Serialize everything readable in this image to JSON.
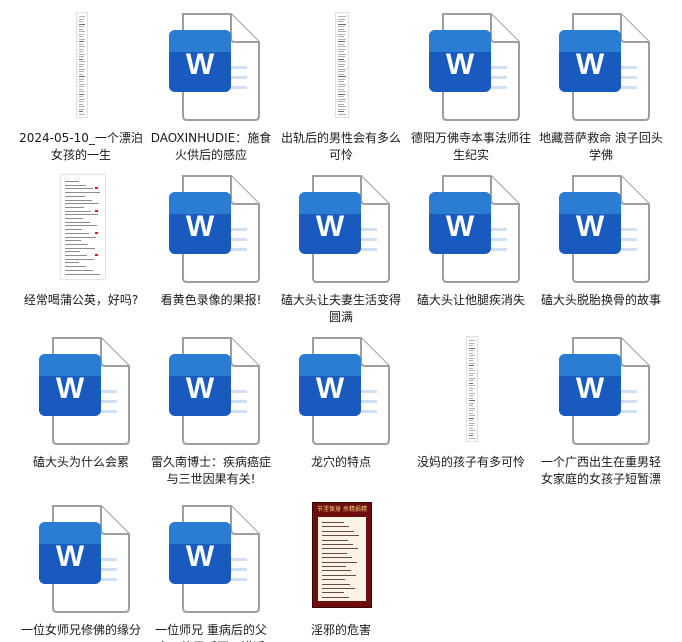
{
  "files": [
    {
      "name": "2024-05-10_一个漂泊女孩的一生",
      "icon": "doc-strip-thumbnail"
    },
    {
      "name": "DAOXINHUDIE：施食火供后的感应",
      "icon": "word-icon"
    },
    {
      "name": "出轨后的男性会有多么可怜",
      "icon": "doc-strip-thumbnail"
    },
    {
      "name": "德阳万佛寺本事法师往生纪实",
      "icon": "word-icon"
    },
    {
      "name": "地藏菩萨救命   浪子回头学佛",
      "icon": "word-icon"
    },
    {
      "name": "经常喝蒲公英，好吗?",
      "icon": "doc-page-thumbnail"
    },
    {
      "name": "看黄色录像的果报!",
      "icon": "word-icon"
    },
    {
      "name": "磕大头让夫妻生活变得圆满",
      "icon": "word-icon"
    },
    {
      "name": "磕大头让他腿疾消失",
      "icon": "word-icon"
    },
    {
      "name": "磕大头脱胎换骨的故事",
      "icon": "word-icon"
    },
    {
      "name": "磕大头为什么会累",
      "icon": "word-icon"
    },
    {
      "name": "雷久南博士：疾病癌症与三世因果有关!",
      "icon": "word-icon"
    },
    {
      "name": "龙穴的特点",
      "icon": "word-icon"
    },
    {
      "name": "没妈的孩子有多可怜",
      "icon": "doc-strip-thumbnail"
    },
    {
      "name": "一个广西出生在重男轻女家庭的女孩子短暂漂泊的一生",
      "icon": "word-icon"
    },
    {
      "name": "一位女师兄修佛的缘分",
      "icon": "word-icon"
    },
    {
      "name": "一位师兄 重病后的父亲，终于听开口讲话",
      "icon": "word-icon"
    },
    {
      "name": "淫邪的危害",
      "icon": "poster-thumbnail"
    }
  ],
  "poster": {
    "heading": "节淫保身 杀精损精"
  },
  "colors": {
    "word_blue": "#185ABD",
    "word_blue_light": "#2B7CD3",
    "page_outline": "#9E9E9E"
  }
}
